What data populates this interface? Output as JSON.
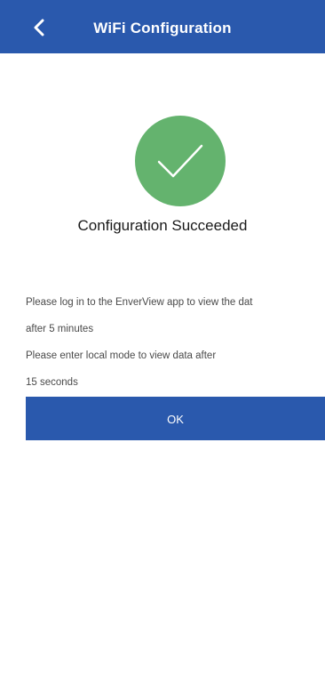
{
  "header": {
    "title": "WiFi Configuration",
    "back_icon": "chevron-left-icon",
    "background_color": "#2a59ad"
  },
  "status": {
    "icon": "check-circle-icon",
    "icon_color": "#64b36e",
    "title": "Configuration Succeeded"
  },
  "message": {
    "line1": "Please log in to the EnverView app to view the dat",
    "line2": "after 5 minutes",
    "line3": " Please enter local mode to view data after",
    "line4": "15 seconds"
  },
  "actions": {
    "ok_label": "OK",
    "button_color": "#2a59ad"
  }
}
